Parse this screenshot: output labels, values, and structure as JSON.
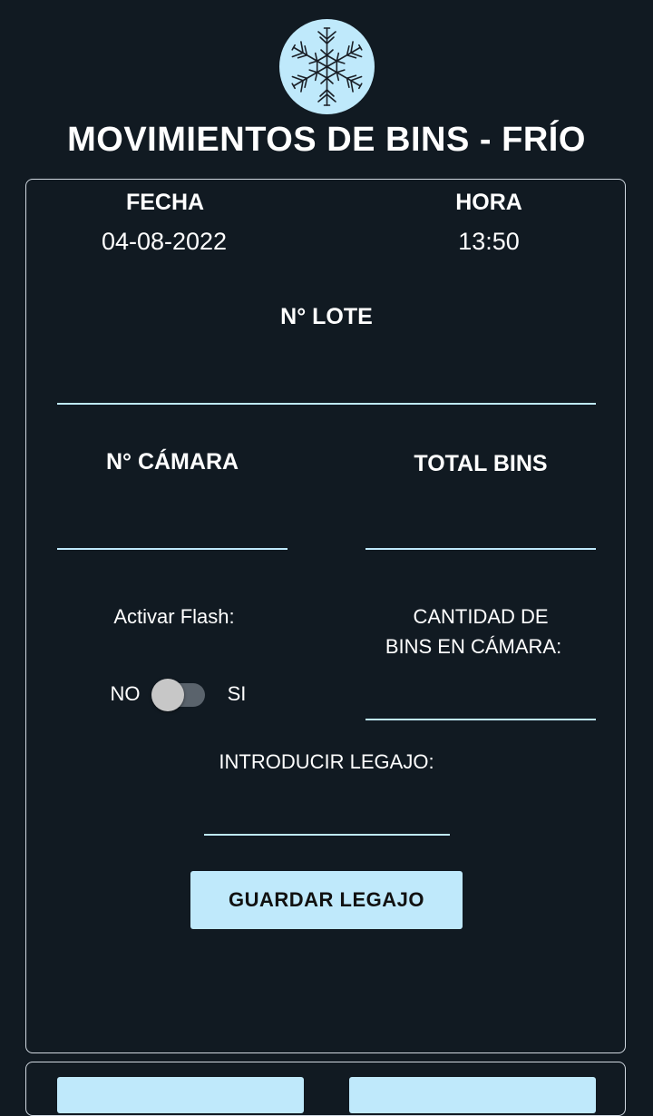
{
  "header": {
    "logo_icon": "snowflake-icon",
    "title": "MOVIMIENTOS DE BINS - FRÍO"
  },
  "form": {
    "fecha_label": "FECHA",
    "fecha_value": "04-08-2022",
    "hora_label": "HORA",
    "hora_value": "13:50",
    "lote_label": "N° LOTE",
    "lote_value": "",
    "camara_label": "N° CÁMARA",
    "camara_value": "",
    "total_bins_label": "TOTAL BINS",
    "total_bins_value": "",
    "flash_label": "Activar Flash:",
    "flash_off_label": "NO",
    "flash_on_label": "SI",
    "flash_enabled": false,
    "cantidad_label_line1": "CANTIDAD DE",
    "cantidad_label_line2": "BINS EN CÁMARA:",
    "cantidad_value": "",
    "legajo_label": "INTRODUCIR LEGAJO:",
    "legajo_value": "",
    "save_button_label": "GUARDAR LEGAJO"
  },
  "colors": {
    "background": "#111a22",
    "accent": "#bfe9fb",
    "text": "#ffffff"
  }
}
